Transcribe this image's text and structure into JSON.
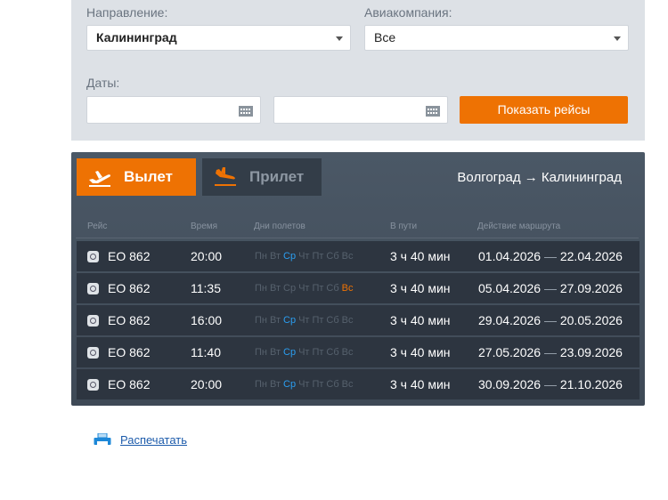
{
  "filters": {
    "direction_label": "Направление:",
    "direction_value": "Калининград",
    "airline_label": "Авиакомпания:",
    "airline_value": "Все",
    "dates_label": "Даты:",
    "date_from": "",
    "date_to": "",
    "show_button": "Показать рейсы"
  },
  "tabs": {
    "departure": "Вылет",
    "arrival": "Прилет"
  },
  "route": "Волгоград → Калининград",
  "columns": {
    "flight": "Рейс",
    "time": "Время",
    "days": "Дни полетов",
    "duration": "В пути",
    "validity": "Действие маршрута"
  },
  "day_names": [
    "Пн",
    "Вт",
    "Ср",
    "Чт",
    "Пт",
    "Сб",
    "Вс"
  ],
  "flights": [
    {
      "flight": "ЕО 862",
      "time": "20:00",
      "active_days": [
        2
      ],
      "duration": "3 ч 40 мин",
      "from": "01.04.2026",
      "sep": "—",
      "to": "22.04.2026"
    },
    {
      "flight": "ЕО 862",
      "time": "11:35",
      "active_days": [
        6
      ],
      "duration": "3 ч 40 мин",
      "from": "05.04.2026",
      "sep": "—",
      "to": "27.09.2026"
    },
    {
      "flight": "ЕО 862",
      "time": "16:00",
      "active_days": [
        2
      ],
      "duration": "3 ч 40 мин",
      "from": "29.04.2026",
      "sep": "—",
      "to": "20.05.2026"
    },
    {
      "flight": "ЕО 862",
      "time": "11:40",
      "active_days": [
        2
      ],
      "duration": "3 ч 40 мин",
      "from": "27.05.2026",
      "sep": "—",
      "to": "23.09.2026"
    },
    {
      "flight": "ЕО 862",
      "time": "20:00",
      "active_days": [
        2
      ],
      "duration": "3 ч 40 мин",
      "from": "30.09.2026",
      "sep": "—",
      "to": "21.10.2026"
    }
  ],
  "print_link": "Распечатать",
  "colors": {
    "accent": "#ee7203",
    "active_day": "#2b9ef0",
    "weekend_active": "#ee7203",
    "board": "#3e4956",
    "link": "#1c5bab"
  }
}
